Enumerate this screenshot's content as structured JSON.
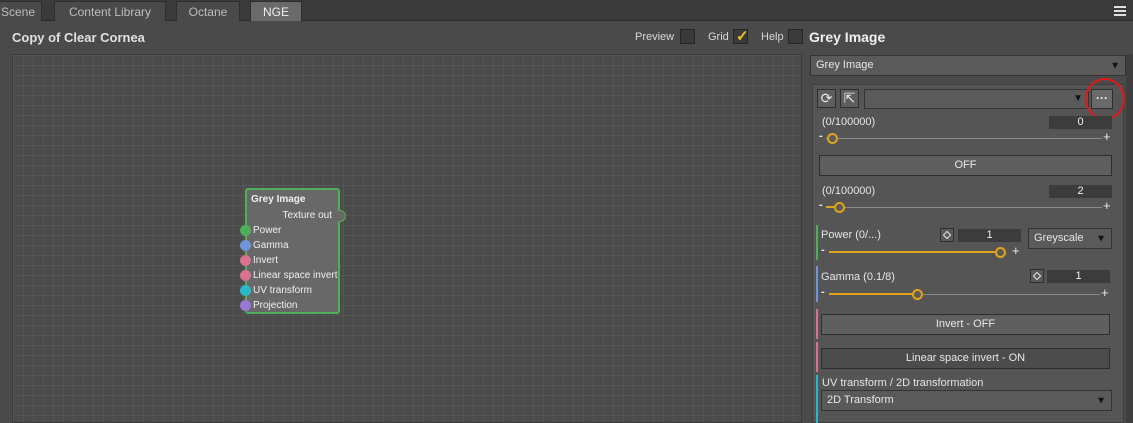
{
  "tabs": [
    {
      "label": "Scene",
      "active": false
    },
    {
      "label": "Content Library",
      "active": false
    },
    {
      "label": "Octane",
      "active": false
    },
    {
      "label": "NGE",
      "active": true
    }
  ],
  "editor": {
    "title": "Copy of Clear Cornea",
    "preview_label": "Preview",
    "preview_checked": false,
    "grid_label": "Grid",
    "grid_checked": true,
    "help_label": "Help",
    "help_checked": false
  },
  "node": {
    "title": "Grey Image",
    "output": "Texture out",
    "inputs": [
      {
        "label": "Power",
        "color": "#4fae5a"
      },
      {
        "label": "Gamma",
        "color": "#6f95d8"
      },
      {
        "label": "Invert",
        "color": "#d7738f"
      },
      {
        "label": "Linear space invert",
        "color": "#d7738f"
      },
      {
        "label": "UV transform",
        "color": "#2ab8c8"
      },
      {
        "label": "Projection",
        "color": "#9b77d6"
      }
    ]
  },
  "panel": {
    "title": "Grey Image",
    "type_select": "Grey Image",
    "preset_select": "",
    "more_button": "···",
    "field1": {
      "range": "(0/100000)",
      "value": "0",
      "fraction": 0.0
    },
    "toggle1": "OFF",
    "field2": {
      "range": "(0/100000)",
      "value": "2",
      "fraction": 0.03
    },
    "power": {
      "label": "Power (0/...)",
      "value": "1",
      "fraction": 1.0,
      "mode": "Greyscale",
      "color": "#4fae5a"
    },
    "gamma": {
      "label": "Gamma (0.1/8)",
      "value": "1",
      "fraction": 0.32,
      "color": "#6f95d8"
    },
    "invert_button": "Invert - OFF",
    "linear_button": "Linear space invert - ON",
    "uv": {
      "label": "UV transform / 2D transformation",
      "select": "2D Transform",
      "color": "#2ab8c8"
    },
    "pink": "#d7738f"
  }
}
